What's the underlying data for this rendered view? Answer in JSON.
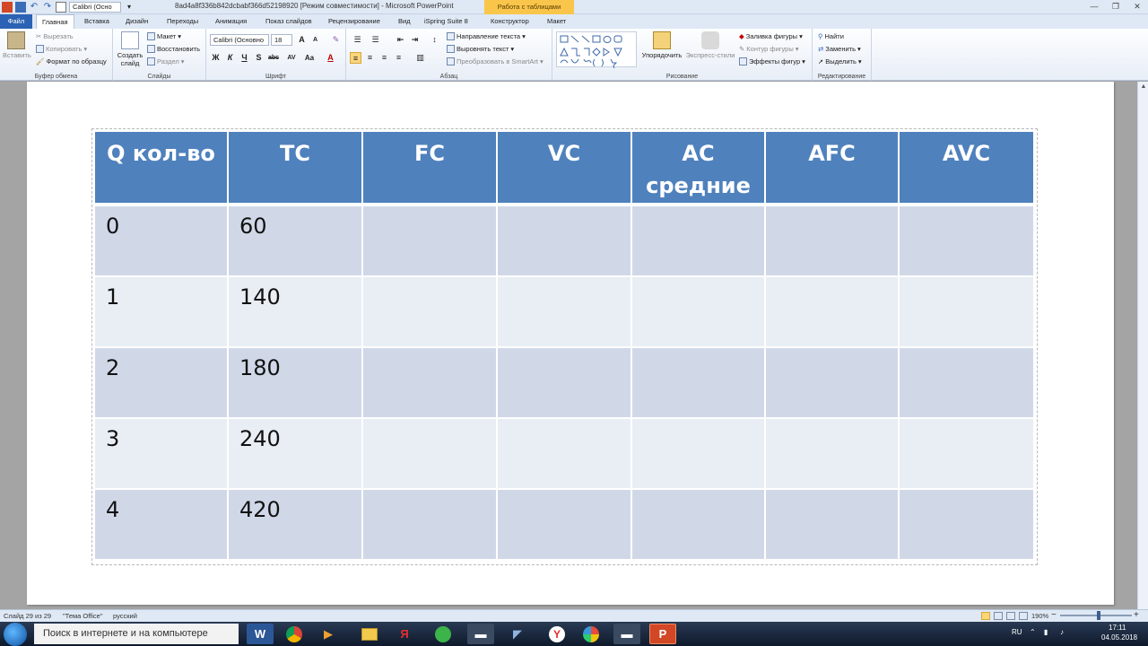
{
  "app": {
    "window_title": "8ad4a8f336b842dcbabf366d52198920 [Режим совместимости] - Microsoft PowerPoint",
    "context_tab_title": "Работа с таблицами",
    "qat_font": "Calibri (Осно"
  },
  "tabs": [
    "Файл",
    "Главная",
    "Вставка",
    "Дизайн",
    "Переходы",
    "Анимация",
    "Показ слайдов",
    "Рецензирование",
    "Вид",
    "iSpring Suite 8",
    "Конструктор",
    "Макет"
  ],
  "ribbon": {
    "clipboard": {
      "label": "Буфер обмена",
      "paste": "Вставить",
      "cut": "Вырезать",
      "copy": "Копировать",
      "format_painter": "Формат по образцу"
    },
    "slides": {
      "label": "Слайды",
      "new_slide": "Создать слайд",
      "layout": "Макет",
      "reset": "Восстановить",
      "section": "Раздел"
    },
    "font": {
      "label": "Шрифт",
      "font_name": "Calibri (Основно",
      "font_size": "18",
      "bold": "Ж",
      "italic": "К",
      "underline": "Ч",
      "shadow": "S",
      "strike": "abc",
      "spacing": "AV",
      "case": "Aa",
      "color": "A"
    },
    "paragraph": {
      "label": "Абзац",
      "text_direction": "Направление текста",
      "align_text": "Выровнять текст",
      "smartart": "Преобразовать в SmartArt"
    },
    "drawing": {
      "label": "Рисование",
      "arrange": "Упорядочить",
      "quick_styles": "Экспресс-стили",
      "shape_fill": "Заливка фигуры",
      "shape_outline": "Контур фигуры",
      "shape_effects": "Эффекты фигур"
    },
    "editing": {
      "label": "Редактирование",
      "find": "Найти",
      "replace": "Заменить",
      "select": "Выделить"
    }
  },
  "table": {
    "headers": [
      "Q кол-во",
      "TC",
      "FC",
      "VC",
      "AC средние",
      "AFC",
      "AVC"
    ],
    "rows": [
      [
        "0",
        "60",
        "",
        "",
        "",
        "",
        ""
      ],
      [
        "1",
        "140",
        "",
        "",
        "",
        "",
        ""
      ],
      [
        "2",
        "180",
        "",
        "",
        "",
        "",
        ""
      ],
      [
        "3",
        "240",
        "",
        "",
        "",
        "",
        ""
      ],
      [
        "4",
        "420",
        "",
        "",
        "",
        "",
        ""
      ]
    ]
  },
  "status": {
    "slide_counter": "Слайд 29 из 29",
    "theme": "\"Тема Office\"",
    "language": "русский",
    "zoom": "190%"
  },
  "taskbar": {
    "search_placeholder": "Поиск в интернете и на компьютере",
    "lang": "RU",
    "time": "17:11",
    "date": "04.05.2018"
  }
}
